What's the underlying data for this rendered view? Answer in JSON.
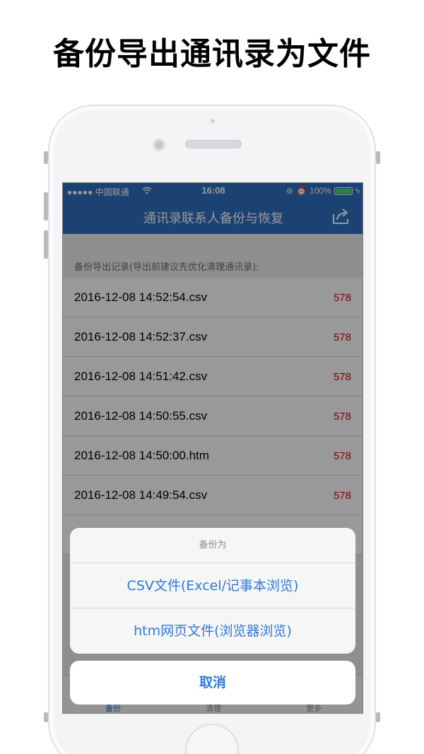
{
  "promo_title": "备份导出通讯录为文件",
  "status_bar": {
    "carrier": "●●●●● 中国联通",
    "time": "16:08",
    "battery_text": "100%"
  },
  "nav": {
    "title": "通讯录联系人备份与恢复",
    "share_icon": "share-icon"
  },
  "section_header": "备份导出记录(导出前建议先优化清理通讯录):",
  "records": [
    {
      "name": "2016-12-08 14:52:54.csv",
      "count": "578"
    },
    {
      "name": "2016-12-08 14:52:37.csv",
      "count": "578"
    },
    {
      "name": "2016-12-08 14:51:42.csv",
      "count": "578"
    },
    {
      "name": "2016-12-08 14:50:55.csv",
      "count": "578"
    },
    {
      "name": "2016-12-08 14:50:00.htm",
      "count": "578"
    },
    {
      "name": "2016-12-08 14:49:54.csv",
      "count": "578"
    }
  ],
  "tabs": [
    {
      "label": "备份"
    },
    {
      "label": "清理"
    },
    {
      "label": "更多"
    }
  ],
  "action_sheet": {
    "title": "备份为",
    "options": [
      {
        "label": "CSV文件(Excel/记事本浏览)"
      },
      {
        "label": "htm网页文件(浏览器浏览)"
      }
    ],
    "cancel": "取消"
  },
  "colors": {
    "nav_blue": "#2f6ec1",
    "count_red": "#d0021b",
    "action_blue": "#2f7ad6"
  }
}
